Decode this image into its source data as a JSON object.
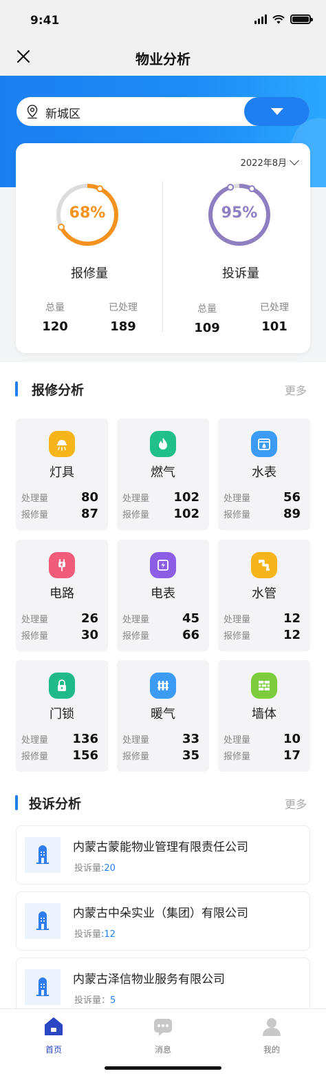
{
  "status": {
    "time": "9:41"
  },
  "nav": {
    "title": "物业分析"
  },
  "district": {
    "name": "新城区"
  },
  "stats": {
    "month": "2022年8月",
    "repair": {
      "percent_label": "68%",
      "percent": 68,
      "title": "报修量",
      "total_label": "总量",
      "total": "120",
      "handled_label": "已处理",
      "handled": "189",
      "color": "#f5921e"
    },
    "complaint": {
      "percent_label": "95%",
      "percent": 95,
      "title": "投诉量",
      "total_label": "总量",
      "total": "109",
      "handled_label": "已处理",
      "handled": "101",
      "color": "#8f7ec0"
    }
  },
  "repair_section": {
    "title": "报修分析",
    "more": "更多",
    "handled_label": "处理量",
    "reported_label": "报修量",
    "items": [
      {
        "name": "灯具",
        "handled": "80",
        "reported": "87",
        "icon": "lamp-icon",
        "color": "#f6b51b"
      },
      {
        "name": "燃气",
        "handled": "102",
        "reported": "102",
        "icon": "flame-icon",
        "color": "#21c08b"
      },
      {
        "name": "水表",
        "handled": "56",
        "reported": "89",
        "icon": "water-meter-icon",
        "color": "#3b9bf5"
      },
      {
        "name": "电路",
        "handled": "26",
        "reported": "30",
        "icon": "plug-icon",
        "color": "#f25c7b"
      },
      {
        "name": "电表",
        "handled": "45",
        "reported": "66",
        "icon": "electric-meter-icon",
        "color": "#8c5ee6"
      },
      {
        "name": "水管",
        "handled": "12",
        "reported": "12",
        "icon": "pipe-icon",
        "color": "#f6b51b"
      },
      {
        "name": "门锁",
        "handled": "136",
        "reported": "156",
        "icon": "lock-icon",
        "color": "#1fba88"
      },
      {
        "name": "暖气",
        "handled": "33",
        "reported": "35",
        "icon": "radiator-icon",
        "color": "#3b9bf5"
      },
      {
        "name": "墙体",
        "handled": "10",
        "reported": "17",
        "icon": "brick-wall-icon",
        "color": "#7ccc3c"
      }
    ]
  },
  "complaint_section": {
    "title": "投诉分析",
    "more": "更多",
    "items": [
      {
        "name": "内蒙古蒙能物业管理有限责任公司",
        "label": "投诉量",
        "sep": ":",
        "count": "20"
      },
      {
        "name": "内蒙古中朵实业（集团）有限公司",
        "label": "投诉量",
        "sep": ":",
        "count": "12"
      },
      {
        "name": "内蒙古泽信物业服务有限公司",
        "label": "投诉量：",
        "sep": "",
        "count": "5"
      }
    ]
  },
  "tabs": [
    {
      "label": "首页",
      "icon": "home-icon",
      "active": true
    },
    {
      "label": "消息",
      "icon": "message-icon",
      "active": false
    },
    {
      "label": "我的",
      "icon": "user-icon",
      "active": false
    }
  ]
}
